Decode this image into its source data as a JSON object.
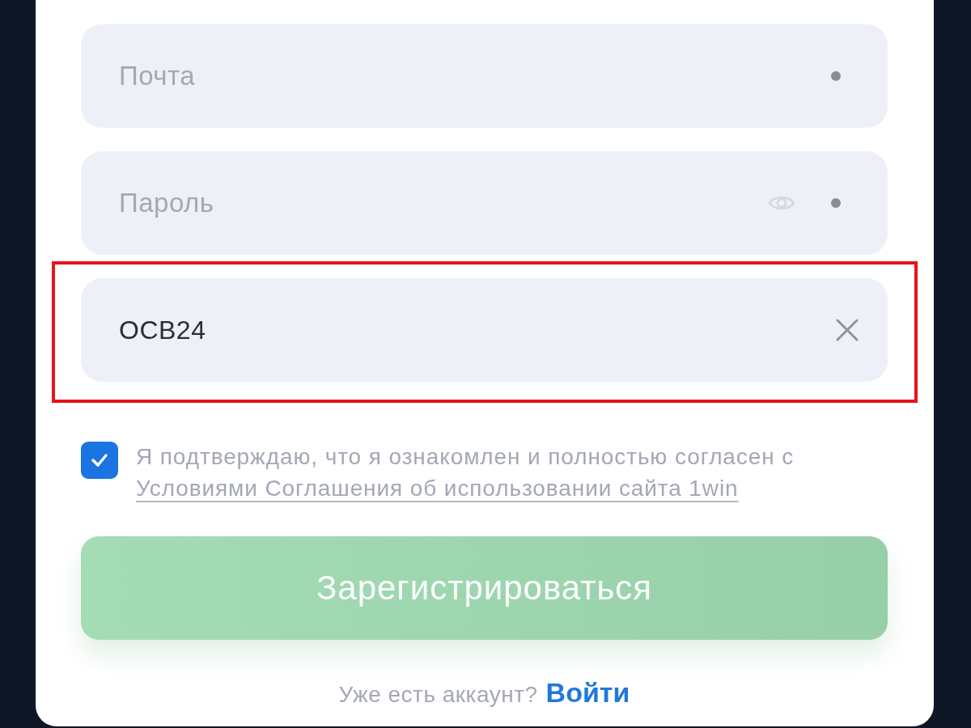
{
  "fields": [
    {
      "kind": "email",
      "placeholder": "Почта",
      "required": true,
      "highlighted": false
    },
    {
      "kind": "password",
      "placeholder": "Пароль",
      "required": true,
      "highlighted": false
    },
    {
      "kind": "promo",
      "value": "OCB24",
      "required": false,
      "highlighted": true
    }
  ],
  "consent": {
    "checked": true,
    "text": "Я подтверждаю, что я ознакомлен и полностью согласен с",
    "link": "Условиями Соглашения об использовании сайта 1win"
  },
  "submit": {
    "label": "Зарегистрироваться",
    "disabled": true
  },
  "footer": {
    "text": "Уже есть аккаунт?",
    "link": "Войти"
  }
}
